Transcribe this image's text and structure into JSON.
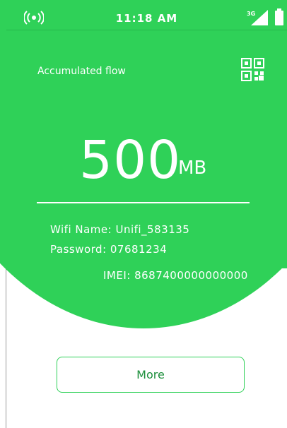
{
  "status": {
    "time": "11:18 AM",
    "network": "3G",
    "icons": [
      "broadcast-signal-icon",
      "cellular-3g-signal-icon",
      "battery-icon"
    ]
  },
  "main": {
    "accumulated_label": "Accumulated flow",
    "qr_icon": "qr-code-icon",
    "flow_value": "500",
    "flow_unit": "MB",
    "wifi_name": "Wifi Name: Unifi_583135",
    "password": "Password: 07681234",
    "imei": "IMEI: 8687400000000000"
  },
  "actions": {
    "more_label": "More"
  },
  "colors": {
    "accent": "#2fd158",
    "button_text": "#1d8f3c",
    "background": "#ffffff"
  }
}
